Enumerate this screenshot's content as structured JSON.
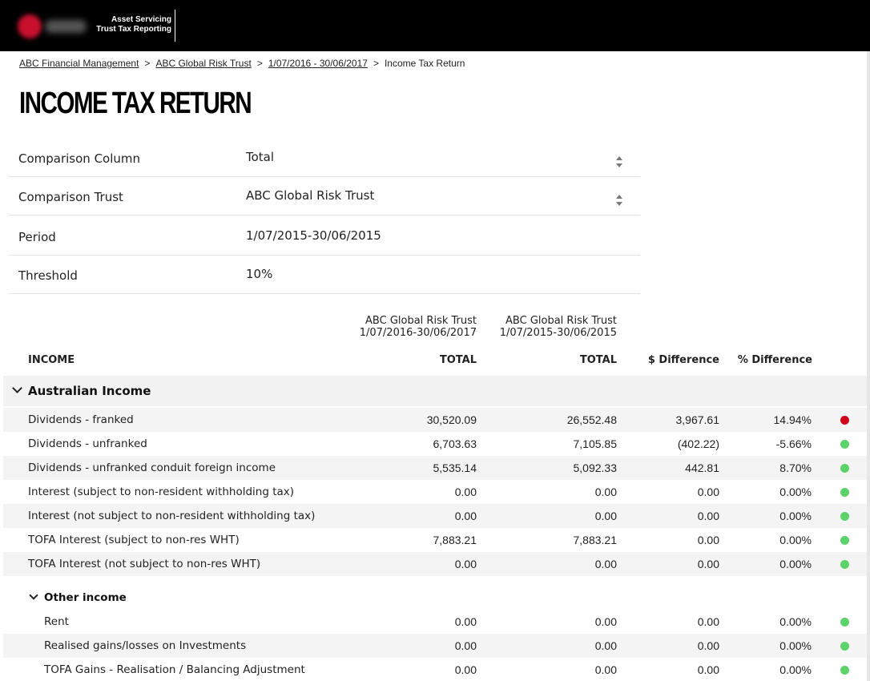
{
  "header": {
    "product_line1": "Asset Servicing",
    "product_line2": "Trust Tax Reporting"
  },
  "breadcrumb": {
    "items": [
      "ABC Financial Management",
      "ABC Global Risk Trust",
      "1/07/2016 - 30/06/2017"
    ],
    "current": "Income Tax Return",
    "separator": ">"
  },
  "page": {
    "title": "INCOME TAX RETURN"
  },
  "form": {
    "comparison_column": {
      "label": "Comparison Column",
      "value": "Total"
    },
    "comparison_trust": {
      "label": "Comparison Trust",
      "value": "ABC Global Risk Trust"
    },
    "period": {
      "label": "Period",
      "value": "1/07/2015-30/06/2015"
    },
    "threshold": {
      "label": "Threshold",
      "value": "10%"
    }
  },
  "table": {
    "col1": {
      "trust": "ABC Global Risk Trust",
      "period": "1/07/2016-30/06/2017",
      "total": "TOTAL"
    },
    "col2": {
      "trust": "ABC Global Risk Trust",
      "period": "1/07/2015-30/06/2015",
      "total": "TOTAL"
    },
    "income_header": "INCOME",
    "diff_header": "$ Difference",
    "pct_header": "% Difference",
    "section_australian": "Australian Income",
    "subsection_other": "Other income",
    "status_colors": {
      "over": "#d0021b",
      "ok": "#5cd26a"
    },
    "rows": [
      {
        "label": "Dividends - franked",
        "v1": "30,520.09",
        "v2": "26,552.48",
        "diff": "3,967.61",
        "pct": "14.94%",
        "status": "over"
      },
      {
        "label": "Dividends - unfranked",
        "v1": "6,703.63",
        "v2": "7,105.85",
        "diff": "(402.22)",
        "pct": "-5.66%",
        "status": "ok"
      },
      {
        "label": "Dividends - unfranked conduit foreign income",
        "v1": "5,535.14",
        "v2": "5,092.33",
        "diff": "442.81",
        "pct": "8.70%",
        "status": "ok"
      },
      {
        "label": "Interest (subject to non-resident withholding tax)",
        "v1": "0.00",
        "v2": "0.00",
        "diff": "0.00",
        "pct": "0.00%",
        "status": "ok"
      },
      {
        "label": "Interest (not subject to non-resident withholding tax)",
        "v1": "0.00",
        "v2": "0.00",
        "diff": "0.00",
        "pct": "0.00%",
        "status": "ok"
      },
      {
        "label": "TOFA Interest (subject to non-res WHT)",
        "v1": "7,883.21",
        "v2": "7,883.21",
        "diff": "0.00",
        "pct": "0.00%",
        "status": "ok"
      },
      {
        "label": "TOFA Interest  (not subject to non-res WHT)",
        "v1": "0.00",
        "v2": "0.00",
        "diff": "0.00",
        "pct": "0.00%",
        "status": "ok"
      }
    ],
    "other_rows": [
      {
        "label": "Rent",
        "v1": "0.00",
        "v2": "0.00",
        "diff": "0.00",
        "pct": "0.00%",
        "status": "ok"
      },
      {
        "label": "Realised gains/losses on Investments",
        "v1": "0.00",
        "v2": "0.00",
        "diff": "0.00",
        "pct": "0.00%",
        "status": "ok"
      },
      {
        "label": "TOFA Gains - Realisation / Balancing Adjustment",
        "v1": "0.00",
        "v2": "0.00",
        "diff": "0.00",
        "pct": "0.00%",
        "status": "ok"
      }
    ]
  }
}
